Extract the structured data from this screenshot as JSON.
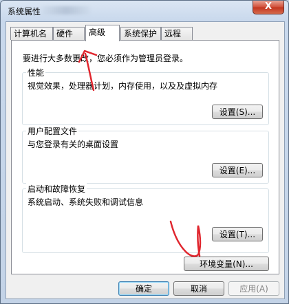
{
  "window": {
    "title": "系统属性",
    "close_glyph": "X"
  },
  "tabs": [
    {
      "label": "计算机名"
    },
    {
      "label": "硬件"
    },
    {
      "label": "高级"
    },
    {
      "label": "系统保护"
    },
    {
      "label": "远程"
    }
  ],
  "panel": {
    "notice": "要进行大多数更改，您必须作为管理员登录。",
    "groups": [
      {
        "title": "性能",
        "description": "视觉效果，处理器计划，内存使用，以及及虚拟内存",
        "button": "设置(S)..."
      },
      {
        "title": "用户配置文件",
        "description": "与您登录有关的桌面设置",
        "button": "设置(E)..."
      },
      {
        "title": "启动和故障恢复",
        "description": "系统启动、系统失败和调试信息",
        "button": "设置(T)..."
      }
    ],
    "env_button": "环境变量(N)..."
  },
  "dialog_buttons": {
    "ok": "确定",
    "cancel": "取消",
    "apply": "应用(A)"
  },
  "colors": {
    "annotation": "#e0262e",
    "close_button": "#c7402b",
    "default_button_border": "#3c7fb1"
  },
  "icons": [
    "close-icon"
  ]
}
